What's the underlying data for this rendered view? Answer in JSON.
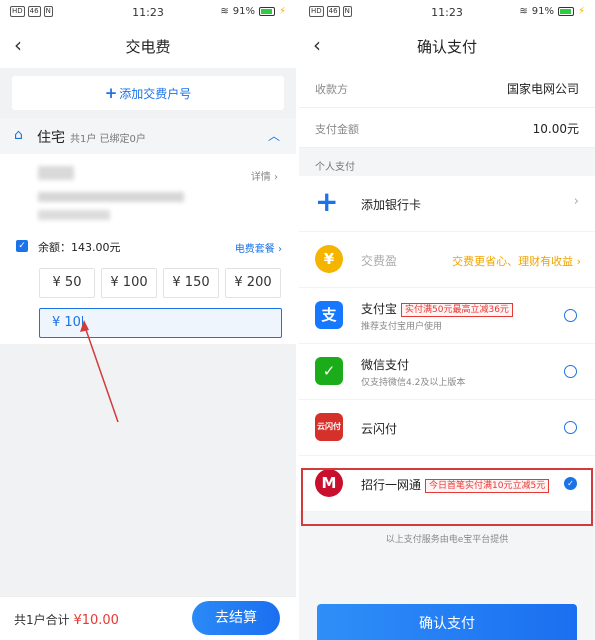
{
  "status_left": {
    "time": "11:23",
    "battery": "91%"
  },
  "status_right": {
    "time": "11:23",
    "battery": "91%"
  },
  "left": {
    "back_glyph": "‹",
    "title": "交电费",
    "add_account": "添加交费户号",
    "house_name": "住宅",
    "house_count": "共1户 已绑定0户",
    "detail": "详情 ›",
    "balance": "余额：143.00元",
    "package": "电费套餐 ›",
    "amounts": [
      "¥ 50",
      "¥ 100",
      "¥ 150",
      "¥ 200"
    ],
    "custom_amount": "¥ 10",
    "total_label": "共1户合计",
    "total_value": "¥10.00",
    "settle": "去结算"
  },
  "right": {
    "back_glyph": "‹",
    "title": "确认支付",
    "payee_label": "收款方",
    "payee_value": "国家电网公司",
    "amount_label": "支付金额",
    "amount_value": "10.00元",
    "section": "个人支付",
    "add_card": "添加银行卡",
    "jfy": "交费盈",
    "jfy_promo": "交费更省心、理财有收益 ›",
    "alipay": "支付宝",
    "alipay_promo": "实付满50元最高立减36元",
    "alipay_sub": "推荐支付宝用户使用",
    "wechat": "微信支付",
    "wechat_sub": "仅支持微信4.2及以上版本",
    "unionpay": "云闪付",
    "cmb": "招行一网通",
    "cmb_promo": "今日首笔实付满10元立减5元",
    "provided": "以上支付服务由电e宝平台提供",
    "confirm": "确认支付"
  },
  "colors": {
    "accent": "#1a73e8",
    "price": "#e53935",
    "highlight": "#d23b3b"
  }
}
